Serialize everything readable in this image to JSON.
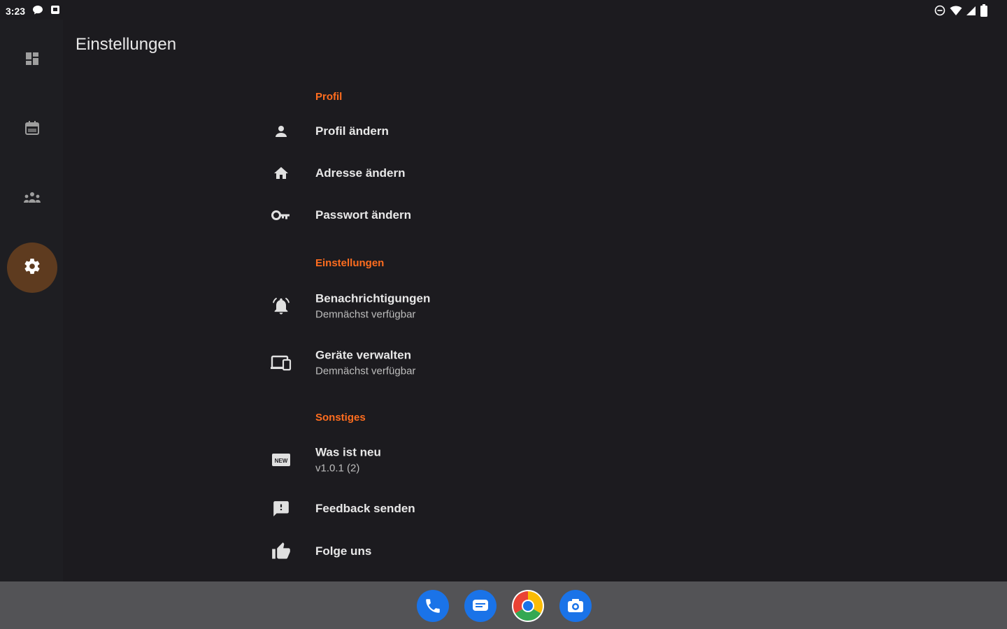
{
  "status_bar": {
    "time": "3:23",
    "left_icons": [
      "chat-bubble-icon",
      "notification-square-icon"
    ],
    "right_icons": [
      "do-not-disturb-icon",
      "wifi-icon",
      "cell-signal-icon",
      "battery-icon"
    ]
  },
  "nav_rail": {
    "items": [
      {
        "icon": "dashboard-icon"
      },
      {
        "icon": "calendar-icon"
      },
      {
        "icon": "groups-icon"
      },
      {
        "icon": "settings-gear-icon",
        "active": true
      }
    ]
  },
  "page": {
    "title": "Einstellungen"
  },
  "sections": {
    "profile": {
      "header": "Profil",
      "items": [
        {
          "icon": "person-icon",
          "label": "Profil ändern"
        },
        {
          "icon": "home-icon",
          "label": "Adresse ändern"
        },
        {
          "icon": "key-icon",
          "label": "Passwort ändern"
        }
      ]
    },
    "settings": {
      "header": "Einstellungen",
      "items": [
        {
          "icon": "notification-bell-icon",
          "label": "Benachrichtigungen",
          "sub": "Demnächst verfügbar"
        },
        {
          "icon": "devices-icon",
          "label": "Geräte verwalten",
          "sub": "Demnächst verfügbar"
        }
      ]
    },
    "other": {
      "header": "Sonstiges",
      "items": [
        {
          "icon": "new-releases-icon",
          "label": "Was ist neu",
          "sub": "v1.0.1 (2)"
        },
        {
          "icon": "feedback-icon",
          "label": "Feedback senden"
        },
        {
          "icon": "thumb-up-icon",
          "label": "Folge uns"
        }
      ]
    }
  },
  "dock": {
    "apps": [
      {
        "name": "phone-app-icon"
      },
      {
        "name": "messages-app-icon"
      },
      {
        "name": "chrome-app-icon"
      },
      {
        "name": "camera-app-icon"
      }
    ]
  },
  "colors": {
    "background": "#1c1b1f",
    "rail_background": "#1e1e22",
    "accent": "#ff6d1f",
    "active_indicator": "#5e3b1f",
    "navbar": "#535356",
    "dock_blue": "#1a73e8"
  }
}
